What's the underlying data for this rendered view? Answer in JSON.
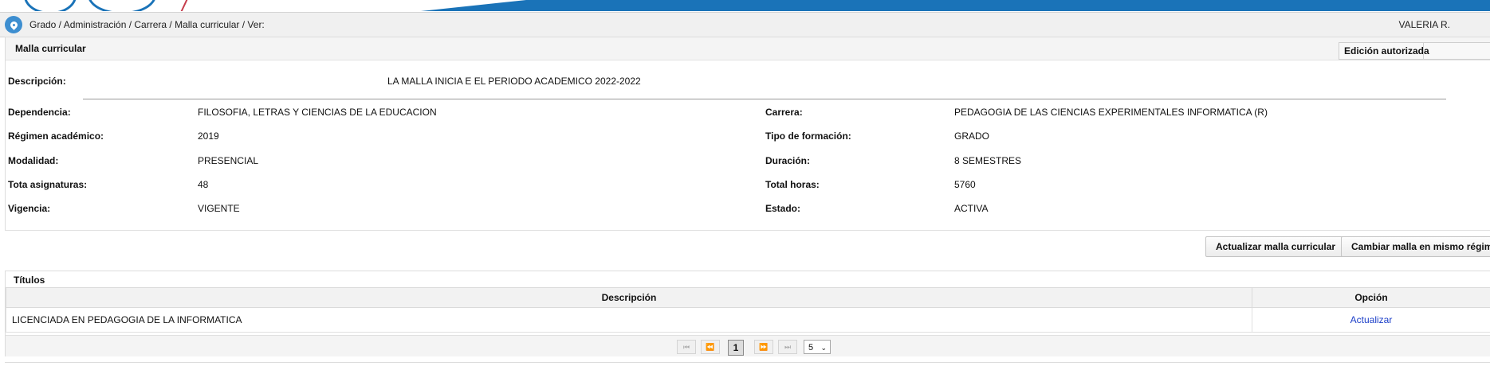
{
  "header": {
    "breadcrumb": "Grado / Administración / Carrera / Malla curricular / Ver:",
    "user": "VALERIA R."
  },
  "malla": {
    "title": "Malla curricular",
    "edicion_label": "Edición autorizada",
    "descripcion_label": "Descripción:",
    "descripcion_value": "LA MALLA INICIA E EL PERIODO ACADEMICO 2022-2022",
    "left_fields": [
      {
        "label": "Dependencia:",
        "value": "FILOSOFIA, LETRAS Y CIENCIAS DE LA EDUCACION"
      },
      {
        "label": "Régimen académico:",
        "value": "2019"
      },
      {
        "label": "Modalidad:",
        "value": "PRESENCIAL"
      },
      {
        "label": "Tota asignaturas:",
        "value": "48"
      },
      {
        "label": "Vigencia:",
        "value": "VIGENTE"
      }
    ],
    "right_fields": [
      {
        "label": "Carrera:",
        "value": "PEDAGOGIA DE LAS CIENCIAS EXPERIMENTALES INFORMATICA (R)"
      },
      {
        "label": "Tipo de formación:",
        "value": "GRADO"
      },
      {
        "label": "Duración:",
        "value": "8 SEMESTRES"
      },
      {
        "label": "Total horas:",
        "value": "5760"
      },
      {
        "label": "Estado:",
        "value": "ACTIVA"
      }
    ]
  },
  "actions": {
    "update_label": "Actualizar malla curricular",
    "change_label": "Cambiar malla en mismo régimen"
  },
  "titulos": {
    "title": "Títulos",
    "columns": [
      "Descripción",
      "Opción"
    ],
    "rows": [
      {
        "descripcion": "LICENCIADA EN PEDAGOGIA DE LA INFORMATICA",
        "opcion": "Actualizar"
      }
    ],
    "pager": {
      "first": "⏮",
      "prev": "⏪",
      "current_page": "1",
      "next": "⏩",
      "last": "⏭",
      "page_size": "5"
    }
  }
}
